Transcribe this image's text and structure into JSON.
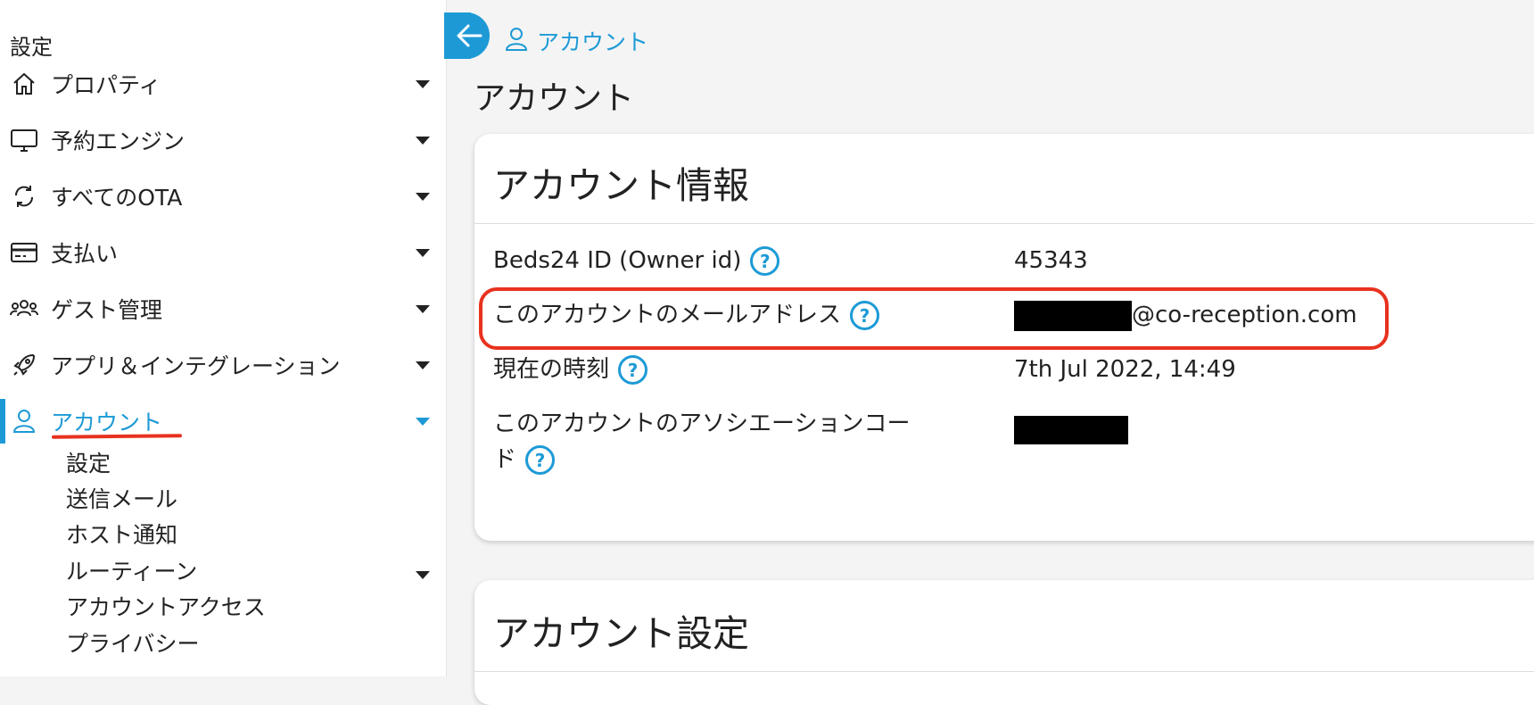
{
  "sidebar": {
    "heading": "設定",
    "items": [
      {
        "label": "プロパティ",
        "icon": "home-icon"
      },
      {
        "label": "予約エンジン",
        "icon": "monitor-icon"
      },
      {
        "label": "すべてのOTA",
        "icon": "sync-icon"
      },
      {
        "label": "支払い",
        "icon": "credit-card-icon"
      },
      {
        "label": "ゲスト管理",
        "icon": "users-icon"
      },
      {
        "label": "アプリ＆インテグレーション",
        "icon": "rocket-icon"
      },
      {
        "label": "アカウント",
        "icon": "user-icon",
        "active": true
      }
    ],
    "sub_items": [
      {
        "label": "設定"
      },
      {
        "label": "送信メール"
      },
      {
        "label": "ホスト通知"
      },
      {
        "label": "ルーティーン",
        "has_caret": true
      },
      {
        "label": "アカウントアクセス"
      },
      {
        "label": "プライバシー"
      }
    ]
  },
  "breadcrumb": {
    "label": "アカウント"
  },
  "page_title": "アカウント",
  "account_info": {
    "title": "アカウント情報",
    "rows": [
      {
        "label": "Beds24 ID (Owner id)",
        "value": "45343"
      },
      {
        "label": "このアカウントのメールアドレス",
        "value": "@co-reception.com"
      },
      {
        "label": "現在の時刻",
        "value": "7th Jul 2022, 14:49"
      },
      {
        "label_line1": "このアカウントのアソシエーションコー",
        "label_line2": "ド"
      }
    ]
  },
  "account_settings": {
    "title": "アカウント設定"
  },
  "colors": {
    "accent": "#1d9ad6",
    "annotation": "#e8321f"
  }
}
